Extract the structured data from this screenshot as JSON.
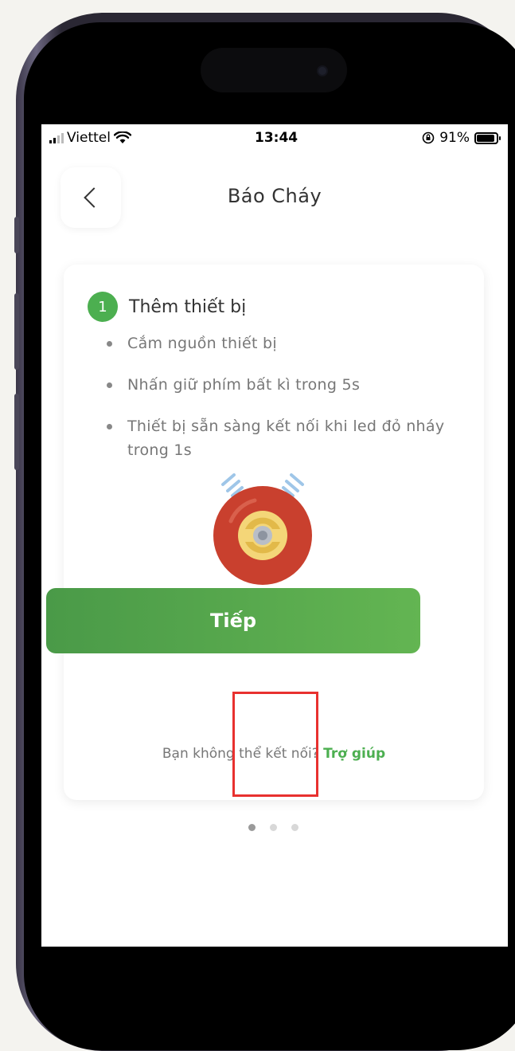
{
  "status_bar": {
    "carrier": "Viettel",
    "time": "13:44",
    "battery": "91%",
    "battery_level": 0.91
  },
  "header": {
    "title": "Báo Cháy",
    "back_icon": "chevron-left-icon"
  },
  "step": {
    "number": "1",
    "title": "Thêm thiết bị",
    "instructions": [
      "Cắm nguồn thiết bị",
      "Nhấn giữ phím bất kì trong 5s",
      "Thiết bị sẵn sàng kết nối khi led đỏ nháy trong 1s"
    ]
  },
  "help": {
    "prompt": "Bạn không thể kết nối?",
    "link": "Trợ giúp"
  },
  "next_button": {
    "label": "Tiếp"
  },
  "pager": {
    "count": 3,
    "active": 0
  },
  "colors": {
    "accent_green": "#4caf50",
    "highlight_red": "#e8312f",
    "alarm_red": "#c9402e",
    "alarm_yellow": "#f4d678"
  }
}
